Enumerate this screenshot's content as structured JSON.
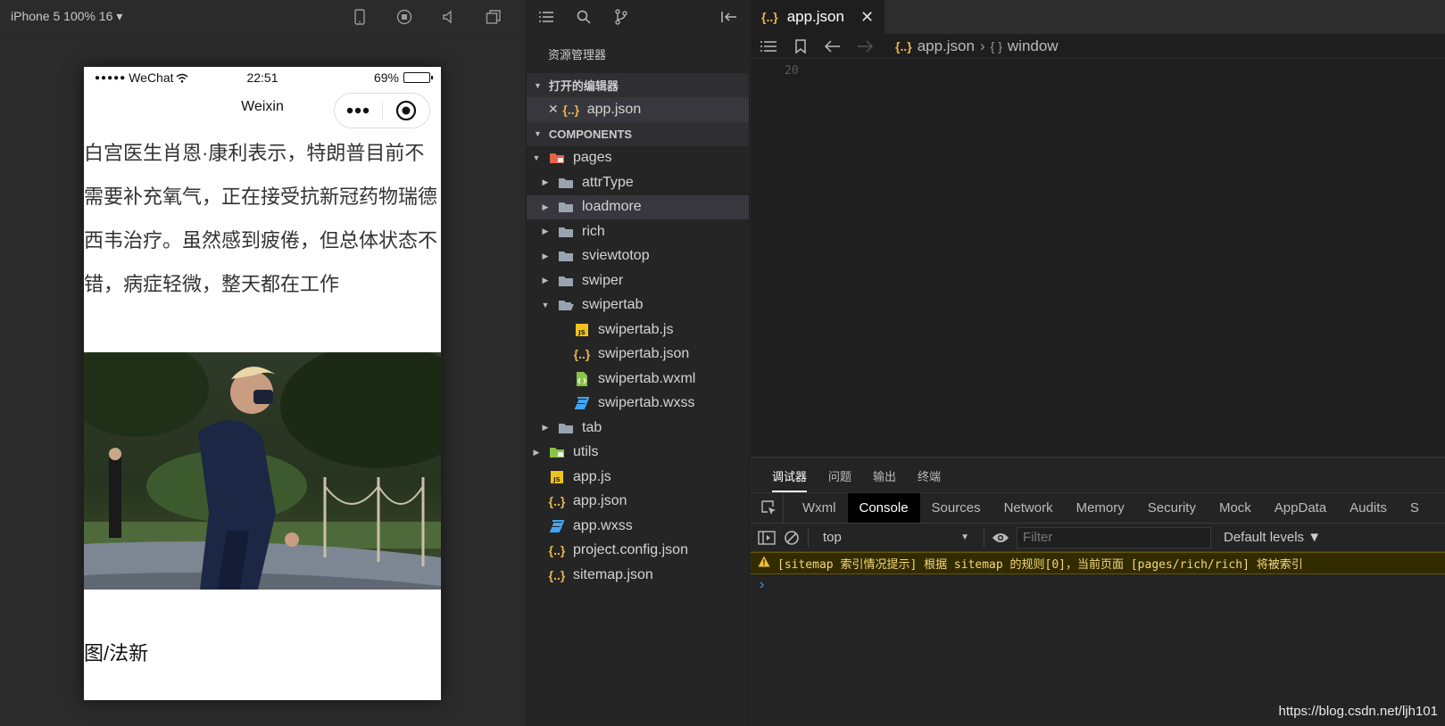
{
  "simulator": {
    "device_label": "iPhone 5 100% 16 ▾",
    "status": {
      "dots": "●●●●●",
      "carrier": "WeChat",
      "time": "22:51",
      "battery": "69%"
    },
    "nav_title": "Weixin",
    "article_text": "白宫医生肖恩·康利表示，特朗普目前不需要补充氧气，正在接受抗新冠药物瑞德西韦治疗。虽然感到疲倦，但总体状态不错，病症轻微，整天都在工作",
    "caption": "图/法新"
  },
  "explorer": {
    "title": "资源管理器",
    "open_editors_label": "打开的编辑器",
    "open_file": "app.json",
    "project_label": "COMPONENTS",
    "tree": [
      {
        "name": "pages",
        "depth": 0,
        "type": "folder-pages",
        "open": true
      },
      {
        "name": "attrType",
        "depth": 1,
        "type": "folder",
        "open": false
      },
      {
        "name": "loadmore",
        "depth": 1,
        "type": "folder",
        "open": false,
        "selected": true
      },
      {
        "name": "rich",
        "depth": 1,
        "type": "folder",
        "open": false
      },
      {
        "name": "sviewtotop",
        "depth": 1,
        "type": "folder",
        "open": false
      },
      {
        "name": "swiper",
        "depth": 1,
        "type": "folder",
        "open": false
      },
      {
        "name": "swipertab",
        "depth": 1,
        "type": "folder-open",
        "open": true
      },
      {
        "name": "swipertab.js",
        "depth": 2,
        "type": "js"
      },
      {
        "name": "swipertab.json",
        "depth": 2,
        "type": "json"
      },
      {
        "name": "swipertab.wxml",
        "depth": 2,
        "type": "wxml"
      },
      {
        "name": "swipertab.wxss",
        "depth": 2,
        "type": "wxss"
      },
      {
        "name": "tab",
        "depth": 1,
        "type": "folder",
        "open": false
      },
      {
        "name": "utils",
        "depth": 0,
        "type": "folder-utils",
        "open": false
      },
      {
        "name": "app.js",
        "depth": 0,
        "type": "js"
      },
      {
        "name": "app.json",
        "depth": 0,
        "type": "json"
      },
      {
        "name": "app.wxss",
        "depth": 0,
        "type": "wxss"
      },
      {
        "name": "project.config.json",
        "depth": 0,
        "type": "json"
      },
      {
        "name": "sitemap.json",
        "depth": 0,
        "type": "json"
      }
    ]
  },
  "editor": {
    "tab_label": "app.json",
    "breadcrumb": [
      "app.json",
      "window"
    ],
    "line_number": "20"
  },
  "devtools": {
    "top_tabs": [
      "调试器",
      "问题",
      "输出",
      "终端"
    ],
    "tabs": [
      "Wxml",
      "Console",
      "Sources",
      "Network",
      "Memory",
      "Security",
      "Mock",
      "AppData",
      "Audits",
      "S"
    ],
    "active_tab": "Console",
    "context": "top",
    "filter_placeholder": "Filter",
    "levels": "Default levels ▼",
    "warning": "[sitemap 索引情况提示] 根据 sitemap 的规则[0]，当前页面 [pages/rich/rich] 将被索引",
    "prompt": "›"
  },
  "watermark": "https://blog.csdn.net/ljh101",
  "colors": {
    "json": "#e8b64a",
    "js": "#f1c21b",
    "wxml": "#8bc34a",
    "wxss": "#42a5f5",
    "folder": "#9aa4b0",
    "pages_folder": "#e0654a",
    "utils_folder": "#8bc34a"
  }
}
